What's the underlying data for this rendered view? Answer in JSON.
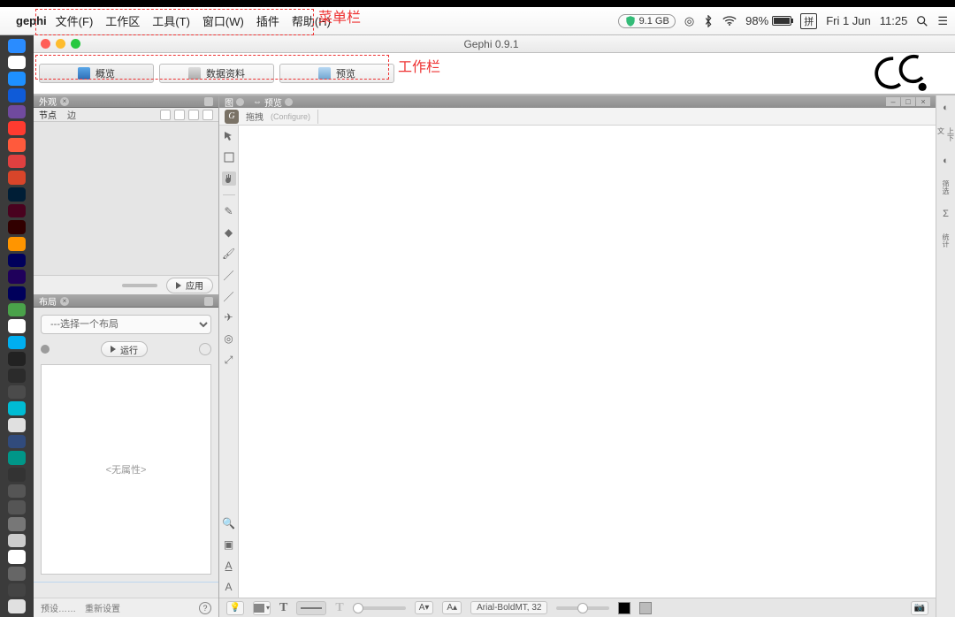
{
  "mac_menu": {
    "app": "gephi",
    "items": [
      "文件(F)",
      "工作区",
      "工具(T)",
      "窗口(W)",
      "插件",
      "帮助(H)"
    ],
    "mem": "9.1 GB",
    "battery_pct": "98%",
    "ime": "拼",
    "date": "Fri 1 Jun",
    "time": "11:25"
  },
  "window": {
    "title": "Gephi 0.9.1"
  },
  "workspace_tabs": {
    "overview": "概览",
    "data": "数据资料",
    "preview": "预览"
  },
  "appearance": {
    "panel_title": "外观",
    "tab_nodes": "节点",
    "tab_edges": "边",
    "apply_btn": "应用"
  },
  "layout": {
    "panel_title": "布局",
    "select_placeholder": "---选择一个布局",
    "run_btn": "运行",
    "no_props": "<无属性>",
    "preset": "预设……",
    "reset": "重新设置"
  },
  "graph_tabs": {
    "graph": "图",
    "preview": "预览",
    "drag_label": "拖拽",
    "configure": "(Configure)"
  },
  "status": {
    "font": "Arial-BoldMT, 32"
  },
  "annotations": {
    "menu": "菜单栏",
    "toolbar": "工作栏"
  },
  "dock_colors": [
    "#2a8cff",
    "#fff",
    "#1e90ff",
    "#0f5bd8",
    "#704a9e",
    "#ff3b30",
    "#ff5a3c",
    "#e04040",
    "#d8452a",
    "#001e36",
    "#49021f",
    "#310000",
    "#ff9500",
    "#00005b",
    "#1f005b",
    "#00005b",
    "#4aa24a",
    "#fff",
    "#00aff0",
    "#222",
    "#2b2b2b",
    "#4b4b4b",
    "#00bcd4",
    "#e0e0e0",
    "#314b7c",
    "#009688",
    "#333",
    "#555",
    "#555",
    "#777",
    "#ccc",
    "#fff",
    "#666",
    "#444",
    "#e0e0e0"
  ]
}
